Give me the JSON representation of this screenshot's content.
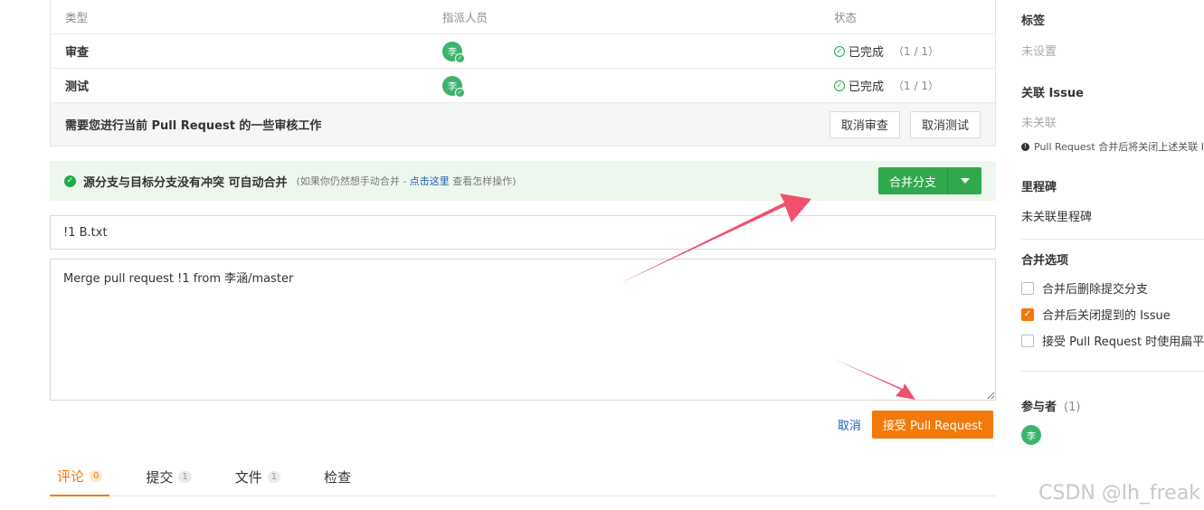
{
  "review": {
    "headers": {
      "type": "类型",
      "assignee": "指派人员",
      "status": "状态"
    },
    "rows": [
      {
        "type": "审查",
        "avatar": "李",
        "status": "已完成",
        "count": "（1 / 1）"
      },
      {
        "type": "测试",
        "avatar": "李",
        "status": "已完成",
        "count": "（1 / 1）"
      }
    ],
    "footer_msg": "需要您进行当前 Pull Request 的一些审核工作",
    "cancel_review": "取消审查",
    "cancel_test": "取消测试"
  },
  "merge": {
    "title": "源分支与目标分支没有冲突 可自动合并",
    "hint_prefix": "(如果你仍然想手动合并 - ",
    "hint_link": "点击这里",
    "hint_suffix": " 查看怎样操作)",
    "button": "合并分支"
  },
  "form": {
    "title_value": "!1 B.txt",
    "body_value": "Merge pull request !1 from 李涵/master",
    "cancel": "取消",
    "accept": "接受 Pull Request"
  },
  "tabs": [
    {
      "label": "评论",
      "count": "0"
    },
    {
      "label": "提交",
      "count": "1"
    },
    {
      "label": "文件",
      "count": "1"
    },
    {
      "label": "检查",
      "count": ""
    }
  ],
  "sidebar": {
    "labels_title": "标签",
    "labels_value": "未设置",
    "issue_title": "关联 Issue",
    "issue_value": "未关联",
    "issue_note": "Pull Request 合并后将关闭上述关联 Is",
    "milestone_title": "里程碑",
    "milestone_value": "未关联里程碑",
    "merge_options_title": "合并选项",
    "options": [
      {
        "label": "合并后删除提交分支",
        "checked": false
      },
      {
        "label": "合并后关闭提到的 Issue",
        "checked": true
      },
      {
        "label": "接受 Pull Request 时使用扁平化",
        "checked": false
      }
    ],
    "participants_title": "参与者",
    "participants_count": "(1)",
    "participant_avatar": "李"
  },
  "watermark": "CSDN @lh_freak",
  "colors": {
    "accent": "#f27a0c",
    "merge_green": "#30a84c",
    "done_green": "#21a94a",
    "annotation_arrow": "#f0506e"
  }
}
